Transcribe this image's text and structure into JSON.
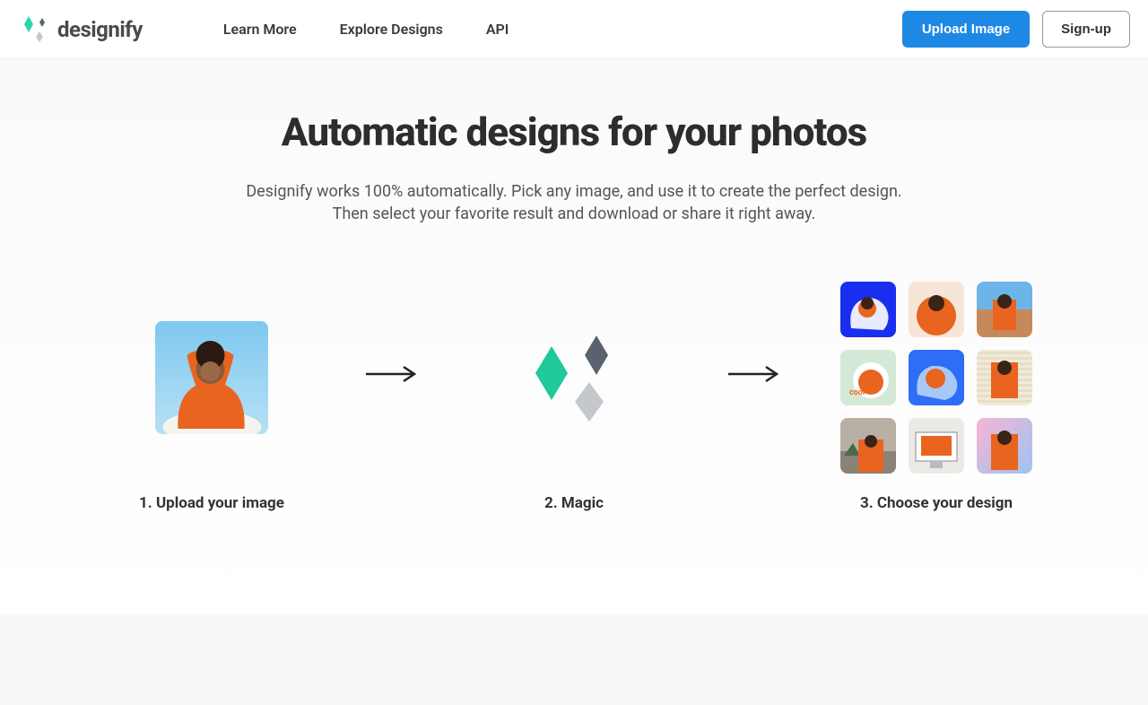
{
  "brand": {
    "name": "designify"
  },
  "nav": {
    "learn_more": "Learn More",
    "explore_designs": "Explore Designs",
    "api": "API"
  },
  "actions": {
    "upload": "Upload Image",
    "signup": "Sign-up"
  },
  "hero": {
    "title": "Automatic designs for your photos",
    "sub_line1": "Designify works 100% automatically. Pick any image, and use it to create the perfect design.",
    "sub_line2": "Then select your favorite result and download or share it right away."
  },
  "steps": {
    "one": "1. Upload your image",
    "two": "2. Magic",
    "three": "3. Choose your design"
  },
  "colors": {
    "accent_green": "#2DD4A7",
    "primary_blue": "#1e88e5"
  }
}
